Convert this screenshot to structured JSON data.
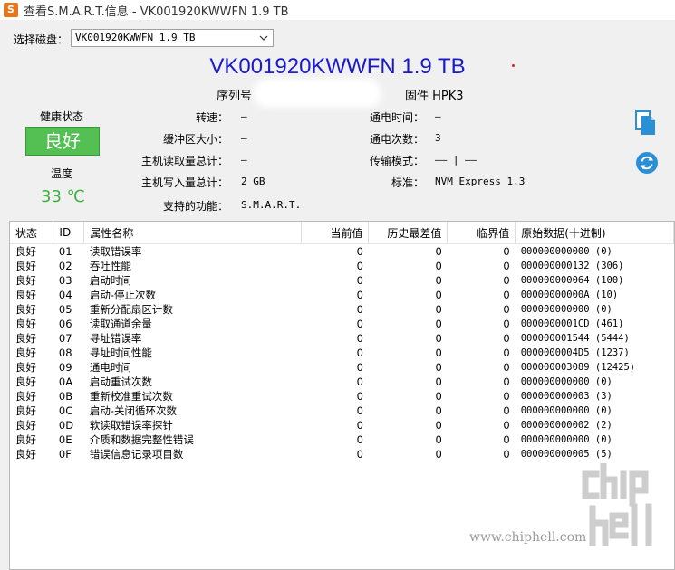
{
  "window": {
    "app_icon_letter": "S",
    "title": "查看S.M.A.R.T.信息 - VK001920KWWFN 1.9 TB"
  },
  "disk_select": {
    "label": "选择磁盘：",
    "value": "VK001920KWWFN 1.9 TB"
  },
  "model_title": "VK001920KWWFN 1.9 TB",
  "serial": {
    "label": "序列号",
    "value": ""
  },
  "firmware": {
    "label": "固件",
    "value": "HPK3"
  },
  "health": {
    "label": "健康状态",
    "status": "良好",
    "status_color": "#54c054"
  },
  "temperature": {
    "label": "温度",
    "value": "33 ℃",
    "color": "#3cb043"
  },
  "info": {
    "rotation_speed": {
      "label": "转速：",
      "value": "—"
    },
    "buffer_size": {
      "label": "缓冲区大小：",
      "value": "—"
    },
    "host_reads": {
      "label": "主机读取量总计：",
      "value": "—"
    },
    "host_writes": {
      "label": "主机写入量总计：",
      "value": "2 GB"
    },
    "features": {
      "label": "支持的功能：",
      "value": "S.M.A.R.T."
    },
    "power_on_hours": {
      "label": "通电时间：",
      "value": "—"
    },
    "power_on_count": {
      "label": "通电次数：",
      "value": "3"
    },
    "transfer_mode": {
      "label": "传输模式：",
      "value": "—— | ——"
    },
    "standard": {
      "label": "标准：",
      "value": "NVM Express 1.3"
    }
  },
  "side_buttons": {
    "copy_icon": "copy-icon",
    "refresh_icon": "refresh-icon",
    "accent": "#2b8fd6"
  },
  "table": {
    "headers": {
      "status": "状态",
      "id": "ID",
      "name": "属性名称",
      "current": "当前值",
      "worst": "历史最差值",
      "threshold": "临界值",
      "raw": "原始数据(十进制)"
    },
    "rows": [
      {
        "status": "良好",
        "id": "01",
        "name": "读取错误率",
        "current": "0",
        "worst": "0",
        "threshold": "0",
        "raw": "000000000000 (0)"
      },
      {
        "status": "良好",
        "id": "02",
        "name": "吞吐性能",
        "current": "0",
        "worst": "0",
        "threshold": "0",
        "raw": "000000000132 (306)"
      },
      {
        "status": "良好",
        "id": "03",
        "name": "启动时间",
        "current": "0",
        "worst": "0",
        "threshold": "0",
        "raw": "000000000064 (100)"
      },
      {
        "status": "良好",
        "id": "04",
        "name": "启动-停止次数",
        "current": "0",
        "worst": "0",
        "threshold": "0",
        "raw": "00000000000A (10)"
      },
      {
        "status": "良好",
        "id": "05",
        "name": "重新分配扇区计数",
        "current": "0",
        "worst": "0",
        "threshold": "0",
        "raw": "000000000000 (0)"
      },
      {
        "status": "良好",
        "id": "06",
        "name": "读取通道余量",
        "current": "0",
        "worst": "0",
        "threshold": "0",
        "raw": "0000000001CD (461)"
      },
      {
        "status": "良好",
        "id": "07",
        "name": "寻址错误率",
        "current": "0",
        "worst": "0",
        "threshold": "0",
        "raw": "000000001544 (5444)"
      },
      {
        "status": "良好",
        "id": "08",
        "name": "寻址时间性能",
        "current": "0",
        "worst": "0",
        "threshold": "0",
        "raw": "0000000004D5 (1237)"
      },
      {
        "status": "良好",
        "id": "09",
        "name": "通电时间",
        "current": "0",
        "worst": "0",
        "threshold": "0",
        "raw": "000000003089 (12425)"
      },
      {
        "status": "良好",
        "id": "0A",
        "name": "启动重试次数",
        "current": "0",
        "worst": "0",
        "threshold": "0",
        "raw": "000000000000 (0)"
      },
      {
        "status": "良好",
        "id": "0B",
        "name": "重新校准重试次数",
        "current": "0",
        "worst": "0",
        "threshold": "0",
        "raw": "000000000003 (3)"
      },
      {
        "status": "良好",
        "id": "0C",
        "name": "启动-关闭循环次数",
        "current": "0",
        "worst": "0",
        "threshold": "0",
        "raw": "000000000000 (0)"
      },
      {
        "status": "良好",
        "id": "0D",
        "name": "软读取错误率探针",
        "current": "0",
        "worst": "0",
        "threshold": "0",
        "raw": "000000000002 (2)"
      },
      {
        "status": "良好",
        "id": "0E",
        "name": "介质和数据完整性错误",
        "current": "0",
        "worst": "0",
        "threshold": "0",
        "raw": "000000000000 (0)"
      },
      {
        "status": "良好",
        "id": "0F",
        "name": "错误信息记录项目数",
        "current": "0",
        "worst": "0",
        "threshold": "0",
        "raw": "000000000005 (5)"
      }
    ]
  },
  "watermark": {
    "logo_text": "chip hell",
    "url": "www.chiphell.com"
  }
}
